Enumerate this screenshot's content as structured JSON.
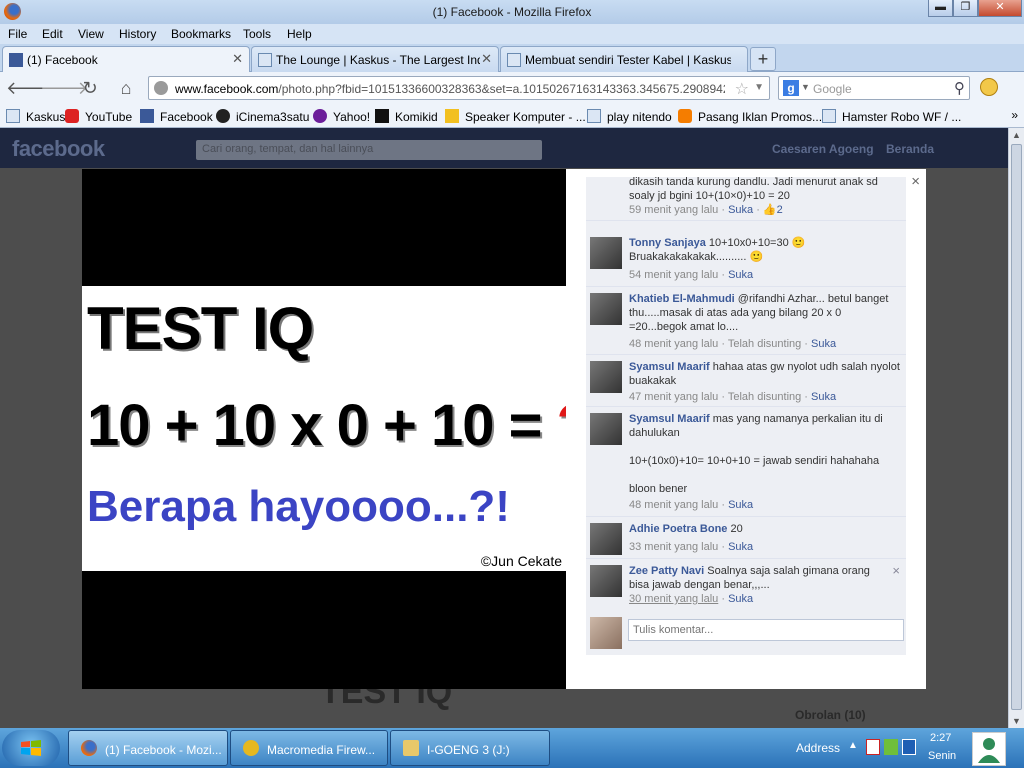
{
  "window": {
    "title": "(1) Facebook - Mozilla Firefox",
    "min": "▬",
    "max": "❐",
    "close": "✕"
  },
  "menu": [
    "File",
    "Edit",
    "View",
    "History",
    "Bookmarks",
    "Tools",
    "Help"
  ],
  "tabs": [
    {
      "label": "(1) Facebook",
      "icon": "facebook-icon",
      "active": true
    },
    {
      "label": "The Lounge | Kaskus - The Largest Ind...",
      "icon": "kaskus-icon"
    },
    {
      "label": "Membuat sendiri Tester Kabel | Kaskus ...",
      "icon": "kaskus-icon"
    }
  ],
  "nav": {
    "back": "🡐",
    "forward": "🡒",
    "reload": "↻",
    "home": "⌂",
    "url_domain": "www.facebook.com",
    "url_rest": "/photo.php?fbid=10151336600328363&set=a.10150267163143363.345675.290894243363",
    "search_placeholder": "Google",
    "search_engine": "g"
  },
  "bookmarks": [
    {
      "label": "Kaskus",
      "icon": "kaskus-icon"
    },
    {
      "label": "YouTube",
      "icon": "youtube-icon"
    },
    {
      "label": "Facebook",
      "icon": "facebook-icon"
    },
    {
      "label": "iCinema3satu",
      "icon": "icinema-icon"
    },
    {
      "label": "Yahoo!",
      "icon": "yahoo-icon"
    },
    {
      "label": "Komikid",
      "icon": "komikid-icon"
    },
    {
      "label": "Speaker Komputer - ...",
      "icon": "speaker-icon"
    },
    {
      "label": "play nitendo",
      "icon": "kaskus-icon"
    },
    {
      "label": "Pasang Iklan Promos...",
      "icon": "blogger-icon"
    },
    {
      "label": "Hamster Robo WF / ...",
      "icon": "kaskus-icon"
    }
  ],
  "bookmarks_more": "»",
  "fb": {
    "logo": "facebook",
    "search_placeholder": "Cari orang, tempat, dan hal lainnya",
    "user": "Caesaren Agoeng",
    "home": "Beranda",
    "behind_title": "TEST IQ",
    "chat": "Obrolan (10)"
  },
  "photo": {
    "line1": "TEST IQ",
    "line2": "10 + 10 x 0 + 10 = ",
    "line2_q": "?",
    "line3": "Berapa hayoooo...?!",
    "credit": "©Jun Cekate"
  },
  "close_label": "×",
  "comments": [
    {
      "name": "",
      "text": "dikasih tanda kurung dandlu. Jadi menurut anak sd soaly jd bgini 10+(10×0)+10 = 20",
      "time": "59 menit yang lalu",
      "extra": "",
      "like": "Suka",
      "likes": "2"
    },
    {
      "name": "Tonny Sanjaya",
      "text": "10+10x0+10=30 🙂 Bruakakakakakak.......... 🙂",
      "time": "54 menit yang lalu",
      "extra": "",
      "like": "Suka"
    },
    {
      "name": "Khatieb El-Mahmudi",
      "text": "@rifandhi Azhar... betul banget thu.....masak di atas ada yang bilang 20 x 0 =20...begok amat lo....",
      "time": "48 menit yang lalu",
      "extra": "Telah disunting",
      "like": "Suka"
    },
    {
      "name": "Syamsul Maarif",
      "text": "hahaa atas gw nyolot udh salah nyolot buakakak",
      "time": "47 menit yang lalu",
      "extra": "Telah disunting",
      "like": "Suka"
    },
    {
      "name": "Syamsul Maarif",
      "text": "mas yang namanya perkalian itu di dahulukan",
      "text2": "10+(10x0)+10= 10+0+10 = jawab sendiri hahahaha",
      "text3": "bloon bener",
      "time": "48 menit yang lalu",
      "extra": "",
      "like": "Suka"
    },
    {
      "name": "Adhie Poetra Bone",
      "text": "20",
      "time": "33 menit yang lalu",
      "extra": "",
      "like": "Suka"
    },
    {
      "name": "Zee Patty Navi",
      "text": "Soalnya saja salah gimana orang bisa jawab dengan benar,,,...",
      "time": "30 menit yang lalu",
      "extra": "",
      "like": "Suka"
    }
  ],
  "comment_box_placeholder": "Tulis komentar...",
  "taskbar": {
    "tasks": [
      {
        "label": "(1) Facebook - Mozi...",
        "icon": "firefox-icon",
        "active": true
      },
      {
        "label": "Macromedia Firew...",
        "icon": "fireworks-icon"
      },
      {
        "label": "I-GOENG 3 (J:)",
        "icon": "folder-icon"
      }
    ],
    "address": "Address",
    "time": "2:27",
    "day": "Senin"
  }
}
